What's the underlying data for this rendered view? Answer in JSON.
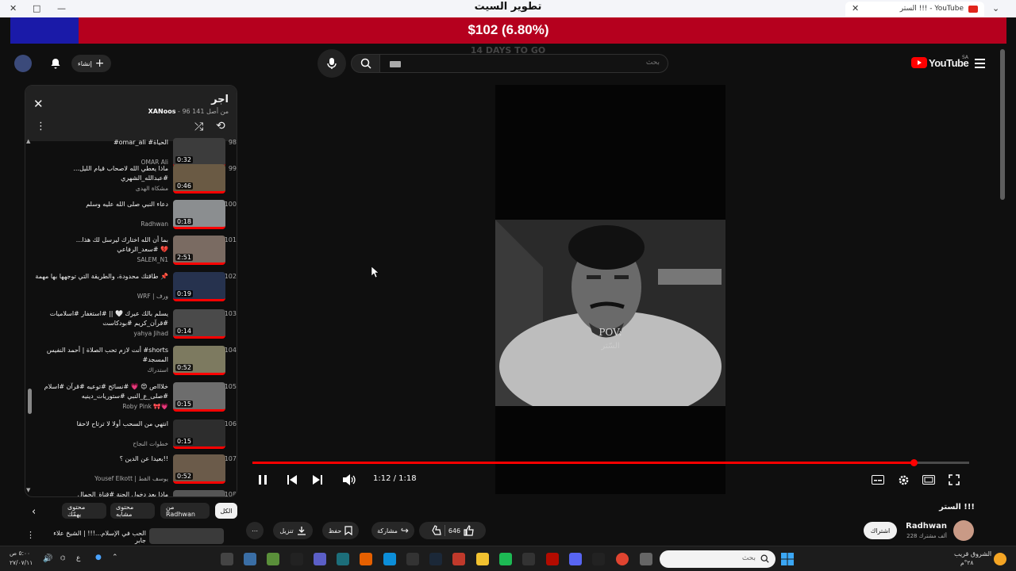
{
  "browser": {
    "page_title": "تطوير السيت",
    "tab_title": "الستر !!! - YouTube",
    "add_tab": "+",
    "close_tab": "✕"
  },
  "ad_banner": {
    "value": "$102 (6.80%)",
    "sub": "14 DAYS TO GO"
  },
  "masthead": {
    "logo_text": "YouTube",
    "region": "SA",
    "search_placeholder": "بحث",
    "create_label": "إنشاء"
  },
  "playlist": {
    "title": "اجر",
    "owner": "XANoos",
    "position": "96 من أصل 141",
    "items": [
      {
        "num": "98",
        "title": "#omar_ali #الحياة",
        "channel": "OMAR Ali",
        "duration": "0:32"
      },
      {
        "num": "99",
        "title": "ماذا يعطي الله لاصحاب قيام الليل... #عبدالله_الشهري",
        "channel": "مشكاة الهدى",
        "duration": "0:46"
      },
      {
        "num": "100",
        "title": "دعاء النبي صلى الله عليه وسلم",
        "channel": "Radhwan",
        "duration": "0:18"
      },
      {
        "num": "101",
        "title": "بما أن الله اختارك ليرسل لك هذا... #سعد_الرفاعي 💔",
        "channel": "SALEM_N1",
        "duration": "2:51"
      },
      {
        "num": "102",
        "title": "طاقتك محدودة، والطريقة التي توجهها بها مهمة 📌",
        "channel": "WRF | ورف",
        "duration": "0:19"
      },
      {
        "num": "103",
        "title": "يسلم بالك عيرك 🤍 || #استغفار #اسلاميات #قرآن_كريم #بودكاست",
        "channel": "yahya Jihad",
        "duration": "0:14"
      },
      {
        "num": "104",
        "title": "أنت لازم تحب الصلاة | أحمد النفيس #shorts #المسجد",
        "channel": "استدراك",
        "duration": "0:52"
      },
      {
        "num": "105",
        "title": "خلاااص 😍 💗 #نسائح #توعيه #قرآن #اسلام #صلى_ع_النبي #ستوريات_دينيه",
        "channel": "Roby Pink 🎀💗",
        "duration": "0:15"
      },
      {
        "num": "106",
        "title": "انتهي من السحب أولا لا ترتاح لاحقا",
        "channel": "خطوات النجاح",
        "duration": "0:15"
      },
      {
        "num": "107",
        "title": "بعيدا عن الدين ؟!!",
        "channel": "Yousef Elkott | يوسف القط",
        "duration": "0:52"
      },
      {
        "num": "108",
        "title": "ماذا بعد دخول الجنة #قناة_الجمال",
        "channel": "",
        "duration": ""
      }
    ]
  },
  "player": {
    "time": "1:12 / 1:18",
    "progress": 0.923,
    "overlay_line1": "POV:",
    "overlay_line2": "السّتر"
  },
  "video": {
    "title": "الستر !!!",
    "channel": "Radhwan",
    "subscribers": "228 ألف مشترك",
    "subscribe_label": "اشتراك",
    "likes": "646",
    "share_label": "مشاركة",
    "save_label": "حفظ",
    "download_label": "تنزيل"
  },
  "chips": [
    "الكل",
    "من Radhwan",
    "محتوى مشابه",
    "محتوى يهمّك"
  ],
  "recommendation": {
    "title": "الحب في الإسلام...!!! | الشيخ علاء جابر"
  },
  "taskbar": {
    "search_placeholder": "بحث",
    "weather": "الشروق قريب",
    "temp": "٢٨°م",
    "lang": "ع",
    "time": "٥:٠٠ ص",
    "date": "٢٧/٠٧/١١",
    "colors": {
      "accent": "#ff0000",
      "dark": "#0f0f0f"
    }
  }
}
